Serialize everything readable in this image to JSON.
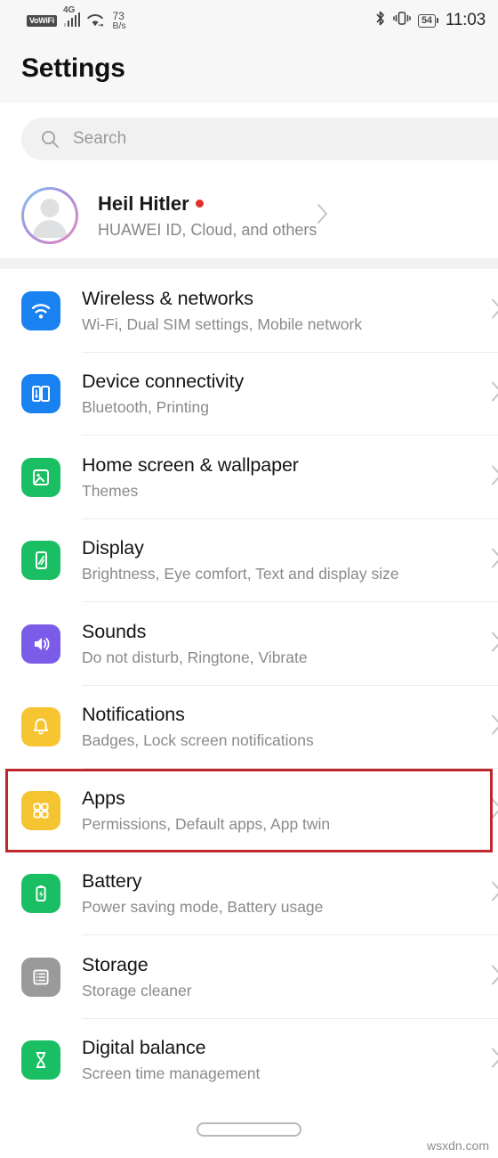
{
  "status_bar": {
    "vowifi_label": "VoWiFi",
    "network_type": "4G",
    "net_speed_value": "73",
    "net_speed_unit": "B/s",
    "battery_percent": "54",
    "time": "11:03",
    "icons": [
      "vowifi-badge",
      "signal-bars-icon",
      "wifi-icon",
      "bluetooth-icon",
      "vibrate-icon",
      "battery-icon"
    ]
  },
  "header": {
    "title": "Settings"
  },
  "search": {
    "placeholder": "Search",
    "value": "",
    "icon": "search-icon"
  },
  "account": {
    "name": "Heil Hitler",
    "subtitle": "HUAWEI ID, Cloud, and others",
    "has_badge": true,
    "badge_color": "#e2312a",
    "avatar_icon": "person-avatar-icon"
  },
  "settings_list": [
    {
      "title": "Wireless & networks",
      "subtitle": "Wi-Fi, Dual SIM settings, Mobile network",
      "icon": "wifi-icon",
      "icon_color": "#1a82f0",
      "highlighted": false
    },
    {
      "title": "Device connectivity",
      "subtitle": "Bluetooth, Printing",
      "icon": "device-connectivity-icon",
      "icon_color": "#1a82f0",
      "highlighted": false
    },
    {
      "title": "Home screen & wallpaper",
      "subtitle": "Themes",
      "icon": "wallpaper-image-icon",
      "icon_color": "#1bbf63",
      "highlighted": false
    },
    {
      "title": "Display",
      "subtitle": "Brightness, Eye comfort, Text and display size",
      "icon": "display-phone-icon",
      "icon_color": "#1bbf63",
      "highlighted": false
    },
    {
      "title": "Sounds",
      "subtitle": "Do not disturb, Ringtone, Vibrate",
      "icon": "speaker-volume-icon",
      "icon_color": "#7b5ce8",
      "highlighted": false
    },
    {
      "title": "Notifications",
      "subtitle": "Badges, Lock screen notifications",
      "icon": "bell-icon",
      "icon_color": "#f7c531",
      "highlighted": false
    },
    {
      "title": "Apps",
      "subtitle": "Permissions, Default apps, App twin",
      "icon": "apps-grid-icon",
      "icon_color": "#f5c431",
      "highlighted": true
    },
    {
      "title": "Battery",
      "subtitle": "Power saving mode, Battery usage",
      "icon": "battery-icon",
      "icon_color": "#1bbf63",
      "highlighted": false
    },
    {
      "title": "Storage",
      "subtitle": "Storage cleaner",
      "icon": "storage-list-icon",
      "icon_color": "#9a9a9a",
      "highlighted": false
    },
    {
      "title": "Digital balance",
      "subtitle": "Screen time management",
      "icon": "hourglass-icon",
      "icon_color": "#1bbf63",
      "highlighted": false
    }
  ],
  "annotation": {
    "highlight_color": "#c0272d",
    "target": "Apps"
  },
  "footer": {
    "home_indicator": "home-indicator-pill",
    "watermark": "wsxdn.com"
  }
}
